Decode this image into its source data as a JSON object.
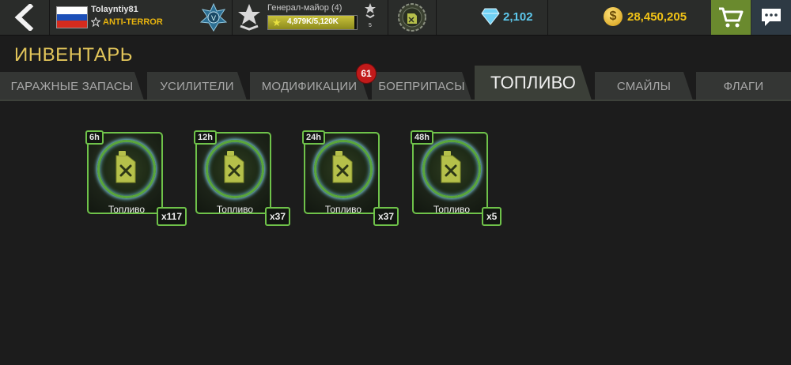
{
  "header": {
    "player_name": "Tolayntiy81",
    "clan_name": "ANTI-TERROR",
    "flag_colors": [
      "#ffffff",
      "#1c4fb8",
      "#d52b1e"
    ],
    "rank_title": "Генерал-майор (4)",
    "xp_text": "4,979K/5,120K",
    "xp_progress": 0.972,
    "next_rank_number": "5",
    "gems": "2,102",
    "coins": "28,450,205",
    "coin_symbol": "$",
    "accent_gold": "#f2c316",
    "accent_gem": "#5dc8ec"
  },
  "page": {
    "title": "ИНВЕНТАРЬ"
  },
  "tabs": [
    {
      "label": "ГАРАЖНЫЕ ЗАПАСЫ",
      "active": false
    },
    {
      "label": "УСИЛИТЕЛИ",
      "active": false
    },
    {
      "label": "МОДИФИКАЦИИ",
      "active": false,
      "badge": "61"
    },
    {
      "label": "БОЕПРИПАСЫ",
      "active": false
    },
    {
      "label": "ТОПЛИВО",
      "active": true
    },
    {
      "label": "СМАЙЛЫ",
      "active": false
    },
    {
      "label": "ФЛАГИ",
      "active": false
    }
  ],
  "items": [
    {
      "duration": "6h",
      "label": "Топливо",
      "quantity": "x117",
      "icon": "jerrycan-icon"
    },
    {
      "duration": "12h",
      "label": "Топливо",
      "quantity": "x37",
      "icon": "jerrycan-icon"
    },
    {
      "duration": "24h",
      "label": "Топливо",
      "quantity": "x37",
      "icon": "jerrycan-icon"
    },
    {
      "duration": "48h",
      "label": "Топливо",
      "quantity": "x5",
      "icon": "jerrycan-icon"
    }
  ],
  "colors": {
    "item_border": "#6fc24a",
    "title": "#e2c55a",
    "badge": "#c11a1a",
    "shop_button": "#6a8a2e"
  }
}
